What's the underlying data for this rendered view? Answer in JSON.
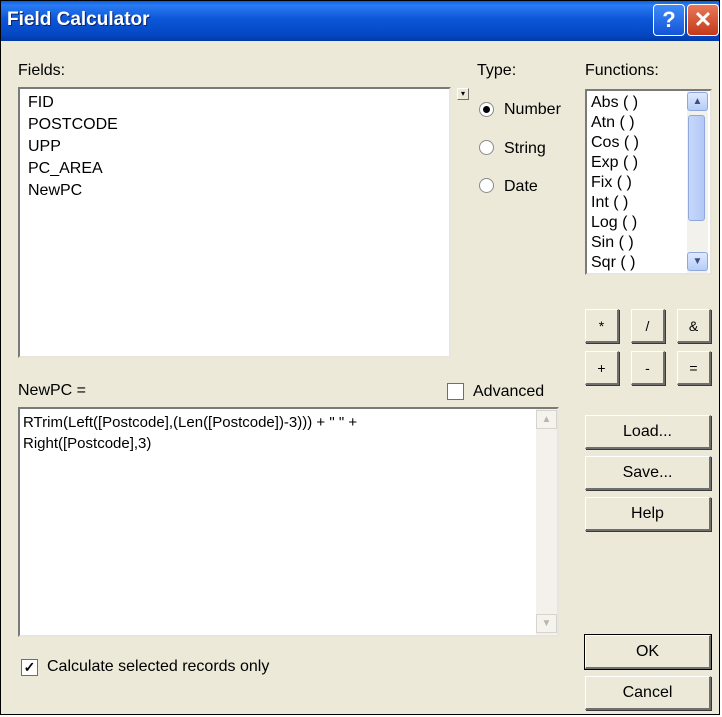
{
  "window": {
    "title": "Field Calculator"
  },
  "titlebar_buttons": {
    "help": "?",
    "close": "✕"
  },
  "fields": {
    "label": "Fields:",
    "items": [
      "FID",
      "POSTCODE",
      "UPP",
      "PC_AREA",
      "NewPC"
    ]
  },
  "type": {
    "label": "Type:",
    "options": [
      {
        "label": "Number",
        "selected": true
      },
      {
        "label": "String",
        "selected": false
      },
      {
        "label": "Date",
        "selected": false
      }
    ]
  },
  "functions": {
    "label": "Functions:",
    "items": [
      "Abs ( )",
      "Atn ( )",
      "Cos ( )",
      "Exp ( )",
      "Fix ( )",
      "Int ( )",
      "Log ( )",
      "Sin ( )",
      "Sqr ( )"
    ]
  },
  "operators": [
    "*",
    "/",
    "&",
    "+",
    "-",
    "="
  ],
  "expression": {
    "label": "NewPC =",
    "line1": "RTrim(Left([Postcode],(Len([Postcode])-3))) + \" \" +",
    "line2": "Right([Postcode],3)"
  },
  "advanced": {
    "label": "Advanced",
    "checked": false
  },
  "buttons": {
    "load": "Load...",
    "save": "Save...",
    "help": "Help",
    "ok": "OK",
    "cancel": "Cancel"
  },
  "calc_selected": {
    "label": "Calculate selected records only",
    "checked": true,
    "mark": "✓"
  }
}
